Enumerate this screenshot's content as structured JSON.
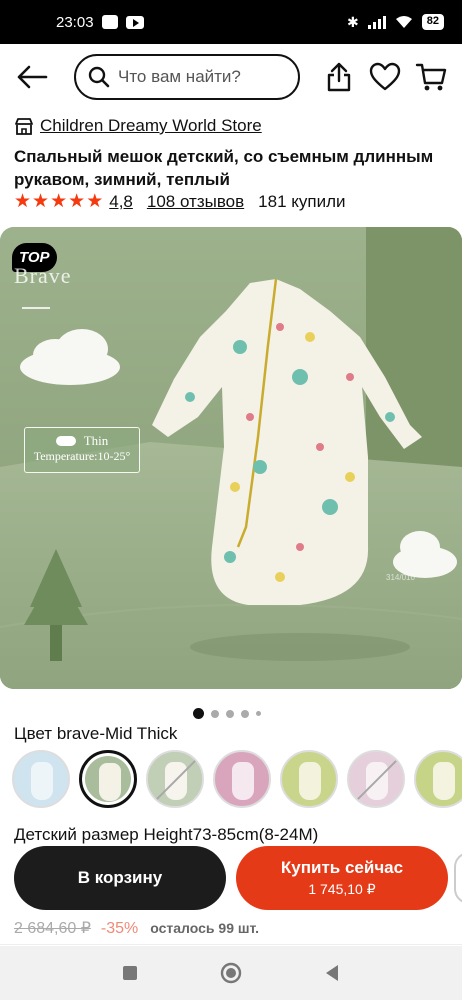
{
  "status_bar": {
    "time": "23:03",
    "battery": "82"
  },
  "search": {
    "placeholder": "Что вам найти?"
  },
  "store": {
    "name": "Children Dreamy World Store"
  },
  "product": {
    "title": "Спальный мешок детский, со съемным длинным рукавом, зимний, теплый",
    "rating": "4,8",
    "reviews": "108 отзывов",
    "purchased": "181 купили",
    "stars_filled": 5
  },
  "image": {
    "badge": "TOP",
    "brand": "Brave",
    "temperature_title": "Thin",
    "temperature_text": "Temperature:10-25°",
    "size_mark": "314/010"
  },
  "gallery": {
    "count": 5,
    "active_index": 0
  },
  "color": {
    "label": "Цвет brave-Mid Thick",
    "options": [
      {
        "bg": "#cfe4ef",
        "suit": "#eef5f8",
        "unavailable": false,
        "selected": false
      },
      {
        "bg": "#a9bd9c",
        "suit": "#f4f1e6",
        "unavailable": false,
        "selected": true
      },
      {
        "bg": "#9fb58f",
        "suit": "#f1eee2",
        "unavailable": true,
        "selected": false
      },
      {
        "bg": "#d9a5bd",
        "suit": "#f5e8ee",
        "unavailable": false,
        "selected": false
      },
      {
        "bg": "#c9d58b",
        "suit": "#f3f2dd",
        "unavailable": false,
        "selected": false
      },
      {
        "bg": "#d8b6c8",
        "suit": "#f4eaef",
        "unavailable": true,
        "selected": false
      },
      {
        "bg": "#c6d488",
        "suit": "#f4f3e0",
        "unavailable": false,
        "selected": false
      }
    ]
  },
  "size": {
    "label": "Детский размер Height73-85cm(8-24M)"
  },
  "actions": {
    "cart_label": "В корзину",
    "buy_label": "Купить сейчас",
    "buy_price": "1 745,10 ₽"
  },
  "pricing": {
    "old_price": "2 684,60 ₽",
    "discount": "-35%",
    "stock": "осталось 99 шт."
  },
  "colors": {
    "accent": "#e53a18",
    "star": "#f53a0f",
    "dark_button": "#1c1c1c"
  }
}
